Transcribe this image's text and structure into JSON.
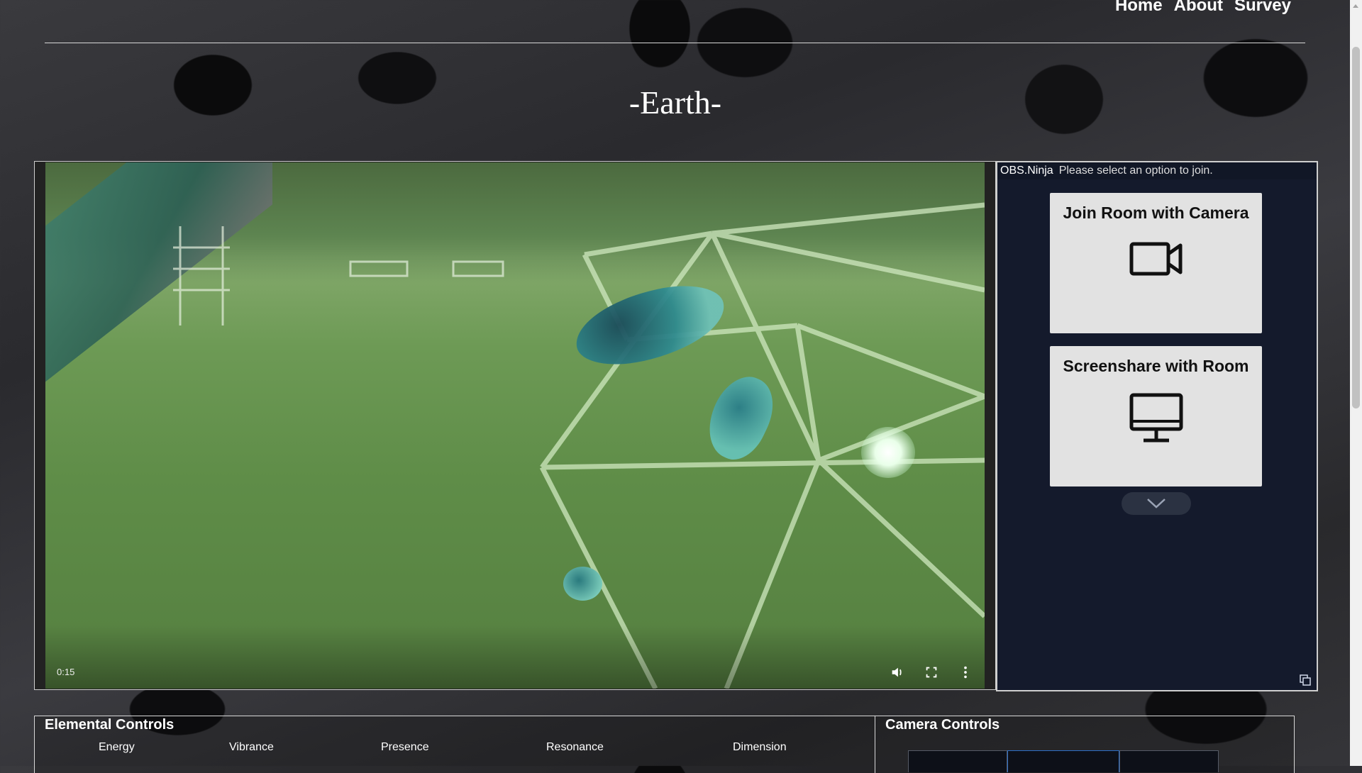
{
  "nav": {
    "home": "Home",
    "about": "About",
    "survey": "Survey"
  },
  "page": {
    "title": "-Earth-"
  },
  "video": {
    "time": "0:15",
    "icons": [
      "volume-icon",
      "fullscreen-icon",
      "more-vertical-icon"
    ]
  },
  "join_panel": {
    "brand": "OBS.Ninja",
    "message": "Please select an option to join.",
    "options": [
      {
        "label": "Join Room with Camera",
        "icon": "video-camera-icon"
      },
      {
        "label": "Screenshare with Room",
        "icon": "monitor-icon"
      }
    ]
  },
  "elemental_controls": {
    "title": "Elemental Controls",
    "labels": [
      "Energy",
      "Vibrance",
      "Presence",
      "Resonance",
      "Dimension"
    ]
  },
  "camera_controls": {
    "title": "Camera Controls"
  },
  "colors": {
    "panel_bg": "#141a2c",
    "card_bg": "#e2e2e2",
    "tab_active": "#2e6fc6"
  }
}
